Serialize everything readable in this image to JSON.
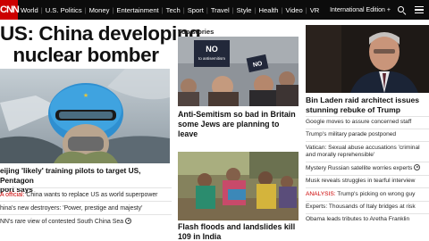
{
  "nav": {
    "logo": "CNN",
    "links": [
      "World",
      "U.S. Politics",
      "Money",
      "Entertainment",
      "Tech",
      "Sport",
      "Travel",
      "Style",
      "Health",
      "Video",
      "VR"
    ],
    "edition": "International Edition +",
    "background": "#0c0c0c",
    "logo_color": "#cc0000"
  },
  "lead": {
    "headline_line1": "US: China developing",
    "headline_line2": "nuclear bomber",
    "caption_line1": "eijing 'likely' training pilots to target US, Pentagon",
    "caption_line2": "port says",
    "items": [
      {
        "prefix": "A official:",
        "text": " China wants to replace US as world superpower"
      },
      {
        "prefix": "",
        "text": "hina's new destroyers: 'Power, prestige and majesty'"
      },
      {
        "prefix": "",
        "text": "NN's rare view of contested South China Sea",
        "video": true
      }
    ]
  },
  "top_stories": {
    "section_title": "Top stories",
    "sign_text_1": "NO",
    "sign_text_2": "to antisemitism",
    "sign_text_3": "NO",
    "story1_line1": "Anti-Semitism so bad in Britain",
    "story1_line2": "some Jews are planning to",
    "story1_line3": "leave",
    "story2_line1": "Flash floods and landslides kill",
    "story2_line2": "109 in India"
  },
  "right": {
    "headline_line1": "Bin Laden raid architect issues",
    "headline_line2": "stunning rebuke of Trump",
    "items": [
      {
        "label": "",
        "lines": [
          "Google moves to assure concerned staff"
        ]
      },
      {
        "label": "",
        "lines": [
          "Trump's military parade postponed"
        ]
      },
      {
        "label": "",
        "lines": [
          "Vatican: Sexual abuse accusations 'criminal",
          "and morally reprehensible'"
        ]
      },
      {
        "label": "",
        "lines": [
          "Mystery Russian satellite worries experts"
        ],
        "video": true
      },
      {
        "label": "",
        "lines": [
          "Musk reveals struggles in tearful interview"
        ]
      },
      {
        "label": "ANALYSIS:",
        "lines": [
          " Trump's picking on wrong guy"
        ]
      },
      {
        "label": "",
        "lines": [
          "Experts: Thousands of Italy bridges at risk"
        ]
      },
      {
        "label": "",
        "lines": [
          "Obama leads tributes to Aretha Franklin"
        ]
      }
    ],
    "accent": "#cc0000"
  }
}
